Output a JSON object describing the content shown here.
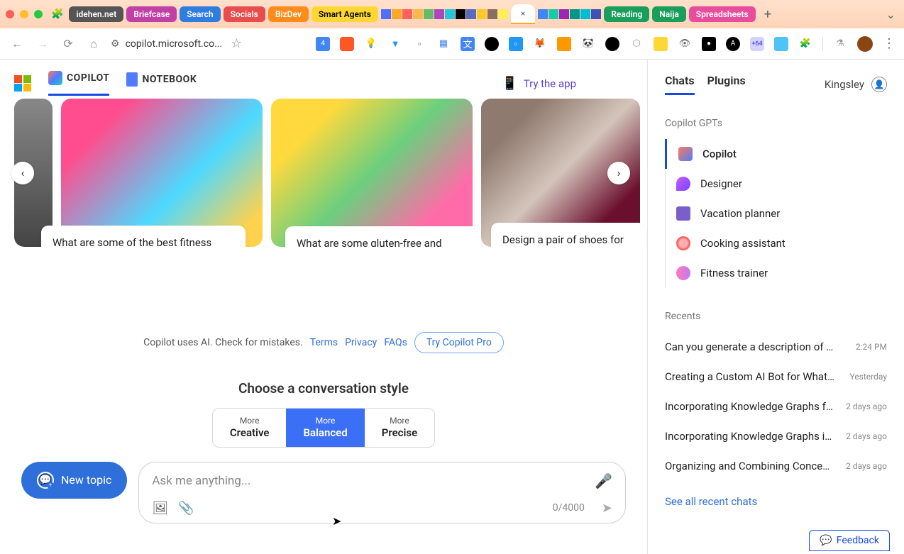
{
  "browser": {
    "tabs": {
      "idehen": "idehen.net",
      "briefcase": "Briefcase",
      "search": "Search",
      "socials": "Socials",
      "bizdev": "BizDev",
      "agents": "Smart Agents",
      "reading": "Reading",
      "naija": "Naija",
      "sheets": "Spreadsheets"
    },
    "active_tab_close": "×",
    "url": "copilot.microsoft.co...",
    "ext_badge_num": "4",
    "ext_plus": "+64"
  },
  "header": {
    "copilot": "COPILOT",
    "notebook": "NOTEBOOK",
    "try_app": "Try the app"
  },
  "cards": {
    "c1": "What are some of the best fitness games and challenges to play?",
    "c2": "What are some gluten-free and vegan recipes using fresh asparagus and radishes?",
    "c3": "Design a pair of shoes for the red carpet made entirely of rhinestones"
  },
  "disclaimer": {
    "text": "Copilot uses AI. Check for mistakes.",
    "terms": "Terms",
    "privacy": "Privacy",
    "faqs": "FAQs",
    "pro": "Try Copilot Pro"
  },
  "style": {
    "title": "Choose a conversation style",
    "more": "More",
    "creative": "Creative",
    "balanced": "Balanced",
    "precise": "Precise"
  },
  "input": {
    "new_topic": "New topic",
    "placeholder": "Ask me anything...",
    "counter": "0/4000"
  },
  "sidebar": {
    "tabs": {
      "chats": "Chats",
      "plugins": "Plugins"
    },
    "user": "Kingsley",
    "gpts_title": "Copilot GPTs",
    "gpts": {
      "copilot": "Copilot",
      "designer": "Designer",
      "vacation": "Vacation planner",
      "cooking": "Cooking assistant",
      "fitness": "Fitness trainer"
    },
    "recents_title": "Recents",
    "recents": [
      {
        "title": "Can you generate a description of Spike",
        "ts": "2:24 PM"
      },
      {
        "title": "Creating a Custom AI Bot for WhatsApp",
        "ts": "Yesterday"
      },
      {
        "title": "Incorporating Knowledge Graphs for Ch",
        "ts": "2 days ago"
      },
      {
        "title": "Incorporating Knowledge Graphs in Ch",
        "ts": "2 days ago"
      },
      {
        "title": "Organizing and Combining Concepts",
        "ts": "2 days ago"
      }
    ],
    "see_all": "See all recent chats",
    "feedback": "Feedback"
  }
}
